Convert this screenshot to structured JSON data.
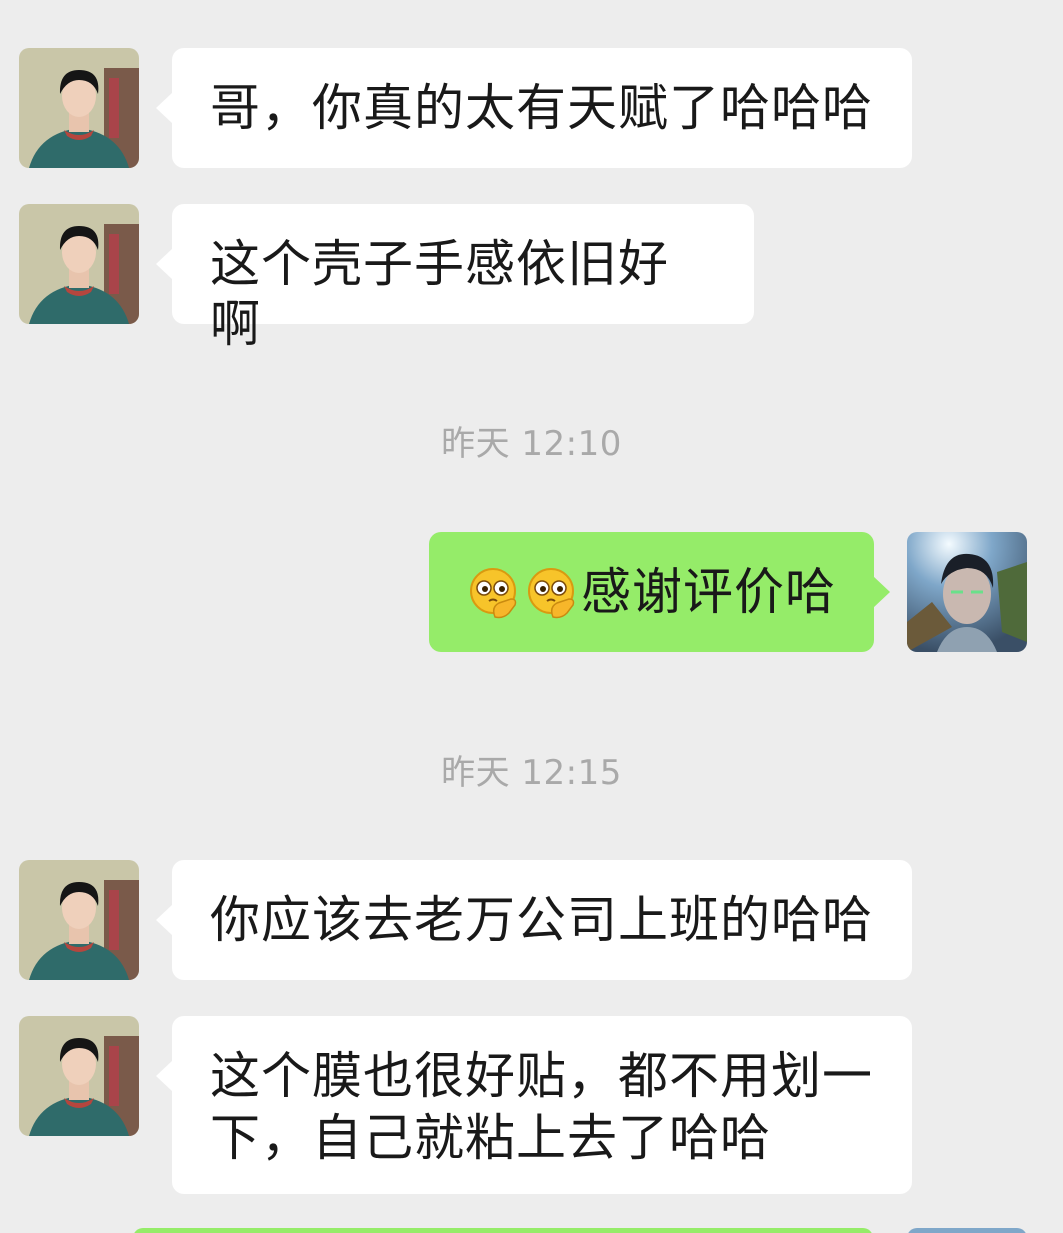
{
  "messages": [
    {
      "side": "in",
      "text": "哥，你真的太有天赋了哈哈哈"
    },
    {
      "side": "in",
      "text": "这个壳子手感依旧好啊"
    },
    {
      "side": "time",
      "text": "昨天 12:10"
    },
    {
      "side": "out",
      "emojis": [
        "thinking-face-emoji",
        "thinking-face-emoji"
      ],
      "text": "感谢评价哈"
    },
    {
      "side": "time",
      "text": "昨天 12:15"
    },
    {
      "side": "in",
      "text": "你应该去老万公司上班的哈哈"
    },
    {
      "side": "in",
      "text_line1": "这个膜也很好贴，都不用划一",
      "text_line2": "下，自己就粘上去了哈哈"
    }
  ],
  "colors": {
    "background": "#ededed",
    "incoming_bubble": "#ffffff",
    "outgoing_bubble": "#95ec69",
    "timestamp_text": "#a9a9a9"
  }
}
